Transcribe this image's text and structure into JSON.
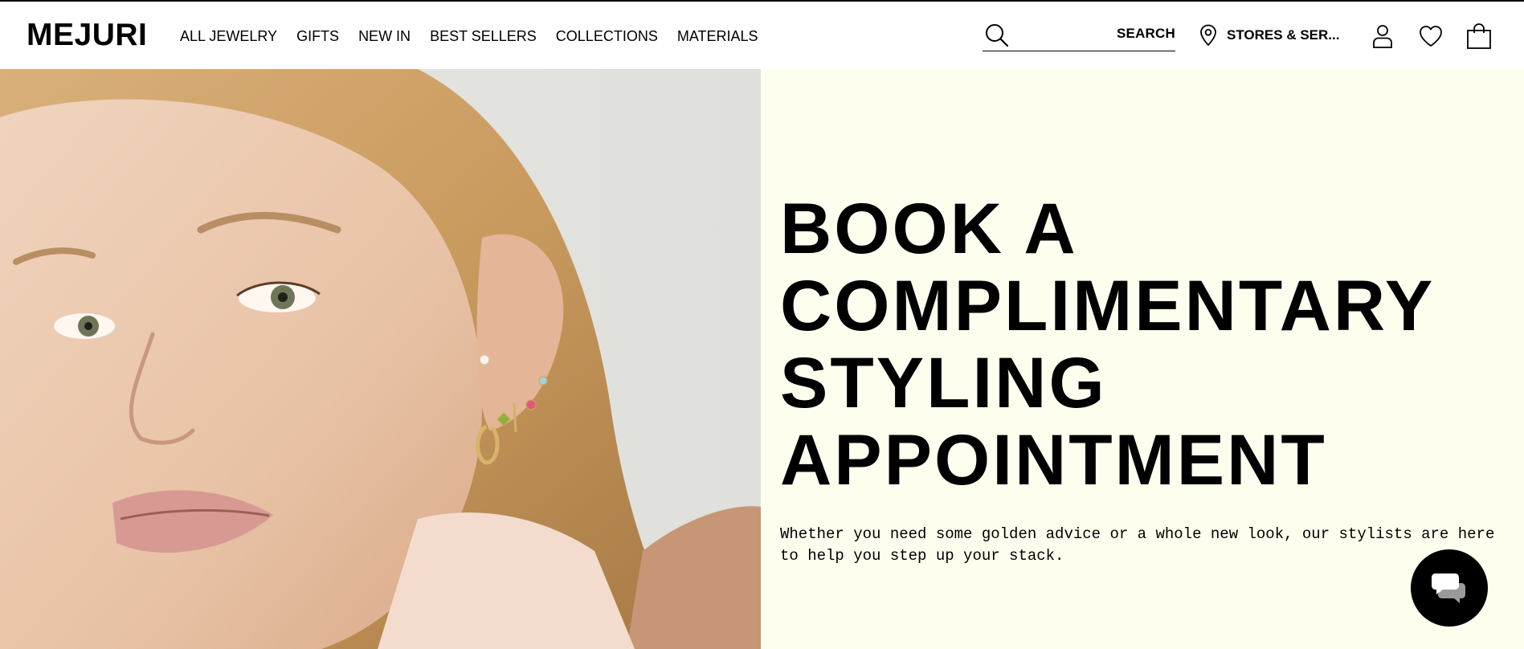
{
  "brand": {
    "logo_text": "MEJURI"
  },
  "nav": {
    "items": [
      {
        "label": "ALL JEWELRY"
      },
      {
        "label": "GIFTS"
      },
      {
        "label": "NEW IN"
      },
      {
        "label": "BEST SELLERS"
      },
      {
        "label": "COLLECTIONS"
      },
      {
        "label": "MATERIALS"
      }
    ]
  },
  "header": {
    "search_label": "SEARCH",
    "stores_label": "STORES & SER...",
    "icons": {
      "search": "search-icon",
      "location": "location-pin-icon",
      "account": "user-icon",
      "wishlist": "heart-icon",
      "bag": "shopping-bag-icon"
    }
  },
  "hero": {
    "headline_lines": [
      "BOOK A",
      "COMPLIMENTARY",
      "STYLING",
      "APPOINTMENT"
    ],
    "body": "Whether you need some golden advice or a whole new look, our stylists are here to help you step up your stack.",
    "panel_color": "#fdfeee"
  },
  "chat": {
    "icon": "chat-bubbles-icon"
  }
}
